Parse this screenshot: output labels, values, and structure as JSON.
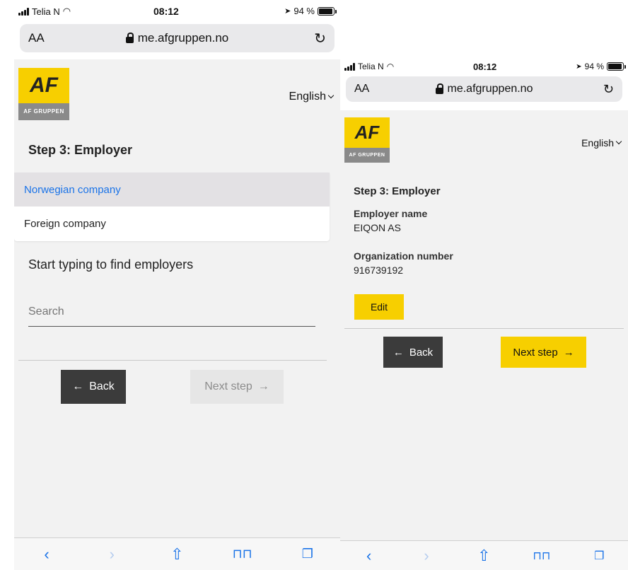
{
  "left": {
    "status": {
      "carrier": "Telia N",
      "time": "08:12",
      "battery": "94 %",
      "battery_level": 0.94
    },
    "browser": {
      "text_size": "AA",
      "host": "me.afgruppen.no"
    },
    "logo": {
      "mark": "AF",
      "caption": "AF GRUPPEN"
    },
    "language": "English",
    "step_title": "Step 3: Employer",
    "tabs": [
      "Norwegian company",
      "Foreign company"
    ],
    "search_heading": "Start typing to find employers",
    "search_placeholder": "Search",
    "back_label": "Back",
    "next_label": "Next step"
  },
  "right": {
    "status": {
      "carrier": "Telia N",
      "time": "08:12",
      "battery": "94 %",
      "battery_level": 0.94
    },
    "browser": {
      "text_size": "AA",
      "host": "me.afgruppen.no"
    },
    "logo": {
      "mark": "AF",
      "caption": "AF GRUPPEN"
    },
    "language": "English",
    "step_title": "Step 3: Employer",
    "employer_name_label": "Employer name",
    "employer_name": "EIQON AS",
    "org_number_label": "Organization number",
    "org_number": "916739192",
    "edit_label": "Edit",
    "back_label": "Back",
    "next_label": "Next step"
  },
  "colors": {
    "brand_yellow": "#f7cf00",
    "link_blue": "#1a73e8",
    "dark_button": "#3b3b3b"
  }
}
